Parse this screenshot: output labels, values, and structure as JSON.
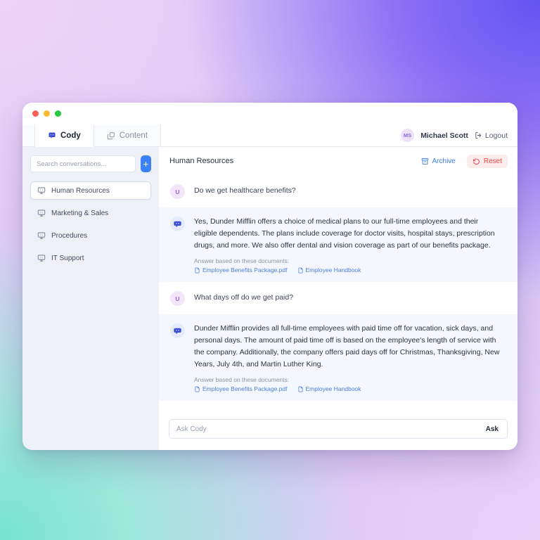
{
  "window": {
    "traffic_lights": [
      "close",
      "minimize",
      "maximize"
    ]
  },
  "tabs": [
    {
      "label": "Cody",
      "icon": "chat-bubble-icon",
      "active": true
    },
    {
      "label": "Content",
      "icon": "copy-layers-icon",
      "active": false
    }
  ],
  "account": {
    "avatar_initials": "MS",
    "name": "Michael Scott",
    "logout_label": "Logout",
    "logout_icon": "logout-icon"
  },
  "sidebar": {
    "search_placeholder": "Search conversations...",
    "search_value": "",
    "add_label": "+",
    "items": [
      {
        "label": "Human Resources",
        "icon": "conversation-icon",
        "active": true
      },
      {
        "label": "Marketing & Sales",
        "icon": "conversation-icon",
        "active": false
      },
      {
        "label": "Procedures",
        "icon": "conversation-icon",
        "active": false
      },
      {
        "label": "IT Support",
        "icon": "conversation-icon",
        "active": false
      }
    ]
  },
  "main": {
    "conversation_title": "Human Resources",
    "actions": {
      "archive_label": "Archive",
      "archive_icon": "archive-box-icon",
      "reset_label": "Reset",
      "reset_icon": "reset-undo-icon"
    },
    "sources_label": "Answer based on these documents:",
    "messages": [
      {
        "role": "user",
        "avatar_initial": "U",
        "text": "Do we get healthcare benefits?"
      },
      {
        "role": "bot",
        "avatar_icon": "cody-bot-icon",
        "text": "Yes, Dunder Mifflin offers a choice of medical plans to our full-time employees and their eligible dependents. The plans include coverage for doctor visits, hospital stays, prescription drugs, and more. We also offer dental and vision coverage as part of our benefits package.",
        "sources": [
          "Employee Benefits Package.pdf",
          "Employee Handbook"
        ]
      },
      {
        "role": "user",
        "avatar_initial": "U",
        "text": "What days off do we get paid?"
      },
      {
        "role": "bot",
        "avatar_icon": "cody-bot-icon",
        "text": "Dunder Mifflin provides all full-time employees with paid time off for vacation, sick days, and personal days. The amount of paid time off is based on the employee's length of service with the company. Additionally, the company offers paid days off for Christmas, Thanksgiving, New Years, July 4th, and Martin Luther King.",
        "sources": [
          "Employee Benefits Package.pdf",
          "Employee Handbook"
        ]
      }
    ]
  },
  "composer": {
    "placeholder": "Ask Cody",
    "value": "",
    "submit_label": "Ask"
  },
  "colors": {
    "accent_blue": "#3b82f6",
    "link_blue": "#4a7fe0",
    "reset_red": "#ef4444",
    "sidebar_bg": "#eef1f8",
    "bot_row_bg": "#f4f7fd"
  }
}
